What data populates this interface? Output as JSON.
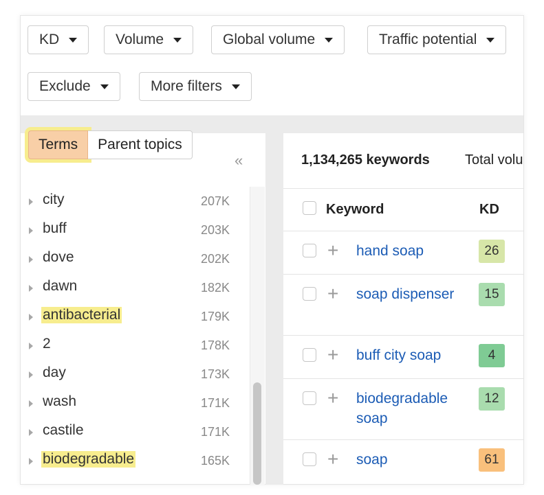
{
  "filters": {
    "row1": [
      {
        "label": "KD"
      },
      {
        "label": "Volume"
      },
      {
        "label": "Global volume"
      },
      {
        "label": "Traffic potential"
      }
    ],
    "row2": [
      {
        "label": "Exclude"
      },
      {
        "label": "More filters"
      }
    ]
  },
  "left_panel": {
    "tabs": {
      "terms": "Terms",
      "parent_topics": "Parent topics"
    },
    "collapse_glyph": "«",
    "terms": [
      {
        "name": "city",
        "count": "207K",
        "highlighted": false
      },
      {
        "name": "buff",
        "count": "203K",
        "highlighted": false
      },
      {
        "name": "dove",
        "count": "202K",
        "highlighted": false
      },
      {
        "name": "dawn",
        "count": "182K",
        "highlighted": false
      },
      {
        "name": "antibacterial",
        "count": "179K",
        "highlighted": true
      },
      {
        "name": "2",
        "count": "178K",
        "highlighted": false
      },
      {
        "name": "day",
        "count": "173K",
        "highlighted": false
      },
      {
        "name": "wash",
        "count": "171K",
        "highlighted": false
      },
      {
        "name": "castile",
        "count": "171K",
        "highlighted": false
      },
      {
        "name": "biodegradable",
        "count": "165K",
        "highlighted": true
      }
    ]
  },
  "results": {
    "keyword_count": "1,134,265 keywords",
    "total_volume_label": "Total volu",
    "columns": {
      "keyword": "Keyword",
      "kd": "KD"
    },
    "rows": [
      {
        "keyword": "hand soap",
        "kd": "26",
        "kd_color": "#d7e6a8"
      },
      {
        "keyword": "soap dispenser",
        "kd": "15",
        "kd_color": "#a9dcae"
      },
      {
        "keyword": "buff city soap",
        "kd": "4",
        "kd_color": "#7fcb94"
      },
      {
        "keyword": "biodegradable soap",
        "kd": "12",
        "kd_color": "#a9dcae"
      },
      {
        "keyword": "soap",
        "kd": "61",
        "kd_color": "#f9c07c"
      }
    ]
  },
  "colors": {
    "link": "#1c5cb5",
    "highlight": "#f7ed8e",
    "active_tab": "#f8cfa7"
  }
}
